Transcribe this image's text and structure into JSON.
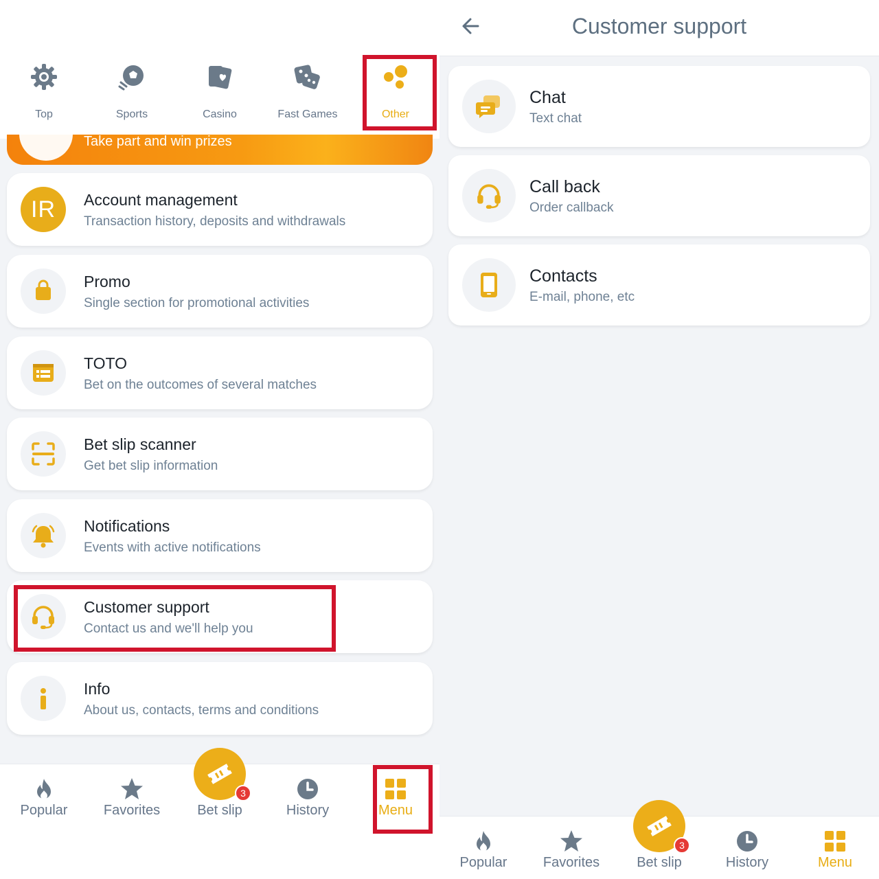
{
  "left": {
    "top_nav": [
      {
        "label": "Top",
        "icon": "gear-icon"
      },
      {
        "label": "Sports",
        "icon": "soccer-ball-icon"
      },
      {
        "label": "Casino",
        "icon": "cards-icon"
      },
      {
        "label": "Fast Games",
        "icon": "dice-icon"
      },
      {
        "label": "Other",
        "icon": "dots-icon",
        "active": true
      }
    ],
    "promo_strip_text": "Take part and win prizes",
    "account": {
      "avatar": "IR",
      "title": "Account management",
      "subtitle": "Transaction history, deposits and withdrawals"
    },
    "menu": [
      {
        "title": "Promo",
        "subtitle": "Single section for promotional activities",
        "icon": "shopping-bag-icon"
      },
      {
        "title": "TOTO",
        "subtitle": "Bet on the outcomes of several matches",
        "icon": "toto-list-icon"
      },
      {
        "title": "Bet slip scanner",
        "subtitle": "Get bet slip information",
        "icon": "scanner-icon"
      },
      {
        "title": "Notifications",
        "subtitle": "Events with active notifications",
        "icon": "bell-icon"
      },
      {
        "title": "Customer support",
        "subtitle": "Contact us and we'll help you",
        "icon": "headset-icon"
      },
      {
        "title": "Info",
        "subtitle": "About us, contacts, terms and conditions",
        "icon": "info-icon"
      }
    ]
  },
  "bottom_nav": {
    "items": [
      {
        "label": "Popular",
        "icon": "flame-icon"
      },
      {
        "label": "Favorites",
        "icon": "star-icon"
      },
      {
        "label": "Bet slip",
        "icon": "ticket-icon",
        "badge": "3"
      },
      {
        "label": "History",
        "icon": "clock-icon"
      },
      {
        "label": "Menu",
        "icon": "grid-icon",
        "active": true
      }
    ]
  },
  "right": {
    "header_title": "Customer support",
    "items": [
      {
        "title": "Chat",
        "subtitle": "Text chat",
        "icon": "chat-bubbles-icon"
      },
      {
        "title": "Call back",
        "subtitle": "Order callback",
        "icon": "headset-icon"
      },
      {
        "title": "Contacts",
        "subtitle": "E-mail, phone, etc",
        "icon": "phone-icon"
      }
    ]
  },
  "colors": {
    "accent": "#e8ad14",
    "highlight": "#d0142c",
    "muted": "#66768a",
    "badge": "#e53935"
  }
}
